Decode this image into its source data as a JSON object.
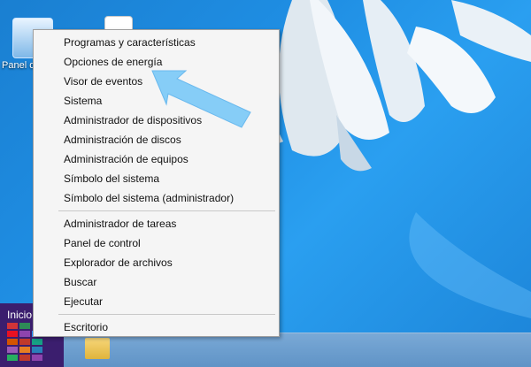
{
  "desktop": {
    "icons": [
      {
        "label": "Panel d",
        "icon": "control-panel-icon"
      },
      {
        "label": "",
        "icon": "document-icon"
      },
      {
        "label": "",
        "icon": "folder-icon"
      }
    ]
  },
  "start": {
    "label": "Inicio"
  },
  "menu": {
    "group1": [
      "Programas y características",
      "Opciones de energía",
      "Visor de eventos",
      "Sistema",
      "Administrador de dispositivos",
      "Administración de discos",
      "Administración de equipos",
      "Símbolo del sistema",
      "Símbolo del sistema (administrador)"
    ],
    "group2": [
      "Administrador de tareas",
      "Panel de control",
      "Explorador de archivos",
      "Buscar",
      "Ejecutar"
    ],
    "group3": [
      "Escritorio"
    ]
  },
  "annotation": {
    "arrow_color": "#7ec8f5",
    "arrow_target": "Opciones de energía"
  },
  "colors": {
    "desktop_bg": "#1f8ee3",
    "taskbar": "#6a9dcf",
    "start_tile": "#3b1e6e",
    "menu_bg": "#f5f5f5"
  }
}
